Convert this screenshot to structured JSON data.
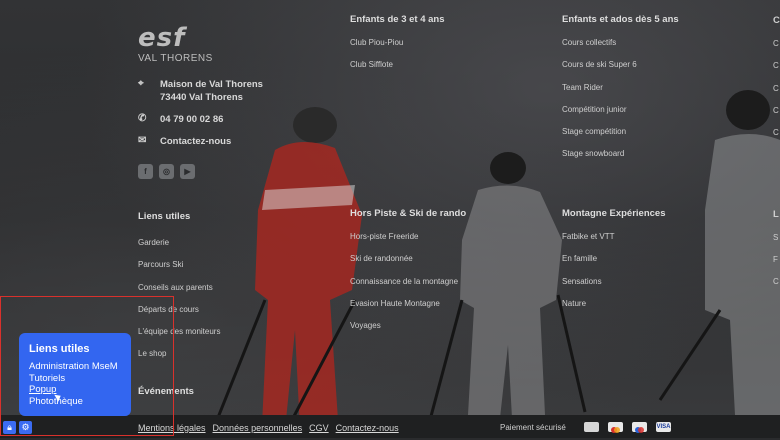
{
  "brand": {
    "logo": "esf",
    "subtitle": "VAL THORENS"
  },
  "contact": {
    "address_line1": "Maison de Val Thorens",
    "address_line2": "73440 Val Thorens",
    "phone": "04 79 00 02 86",
    "contact_link": "Contactez-nous",
    "icons": [
      "location-pin-icon",
      "phone-icon",
      "mail-icon"
    ]
  },
  "socials": [
    "f",
    "◎",
    "▶"
  ],
  "columns": {
    "kids": {
      "title": "Enfants de 3 et 4 ans",
      "items": [
        "Club Piou-Piou",
        "Club Sifflote"
      ]
    },
    "teens": {
      "title": "Enfants et ados dès 5 ans",
      "items": [
        "Cours collectifs",
        "Cours de ski Super 6",
        "Team Rider",
        "Compétition junior",
        "Stage compétition",
        "Stage snowboard"
      ]
    },
    "links": {
      "title": "Liens utiles",
      "items": [
        "Garderie",
        "Parcours Ski",
        "Conseils aux parents",
        "Départs de cours",
        "L'équipe des moniteurs",
        "Le shop"
      ]
    },
    "offpiste": {
      "title": "Hors Piste & Ski de rando",
      "items": [
        "Hors-piste Freeride",
        "Ski de randonnée",
        "Connaissance de la montagne",
        "Evasion Haute Montagne",
        "Voyages"
      ]
    },
    "mountain": {
      "title": "Montagne Expériences",
      "items": [
        "Fatbike et VTT",
        "En famille",
        "Sensations",
        "Nature"
      ]
    },
    "events": {
      "title": "Événements"
    }
  },
  "edge_letters": [
    "C",
    "C",
    "C",
    "C",
    "C",
    "C",
    "L",
    "S",
    "F",
    "C"
  ],
  "footer": {
    "legal": [
      "Mentions légales",
      "Données personnelles",
      "CGV",
      "Contactez-nous"
    ],
    "payment_label": "Paiement sécurisé",
    "cards": [
      "card-generic",
      "mastercard",
      "maestro",
      "visa"
    ],
    "visa_text": "VISA"
  },
  "admin_popup": {
    "title": "Liens utiles",
    "items": [
      "Administration MseM",
      "Tutoriels",
      "Popup",
      "Photothèque"
    ],
    "active_item": "Popup"
  },
  "colors": {
    "accent": "#3366f0",
    "frame": "#d9312c",
    "skier_red": "#b3261e"
  }
}
